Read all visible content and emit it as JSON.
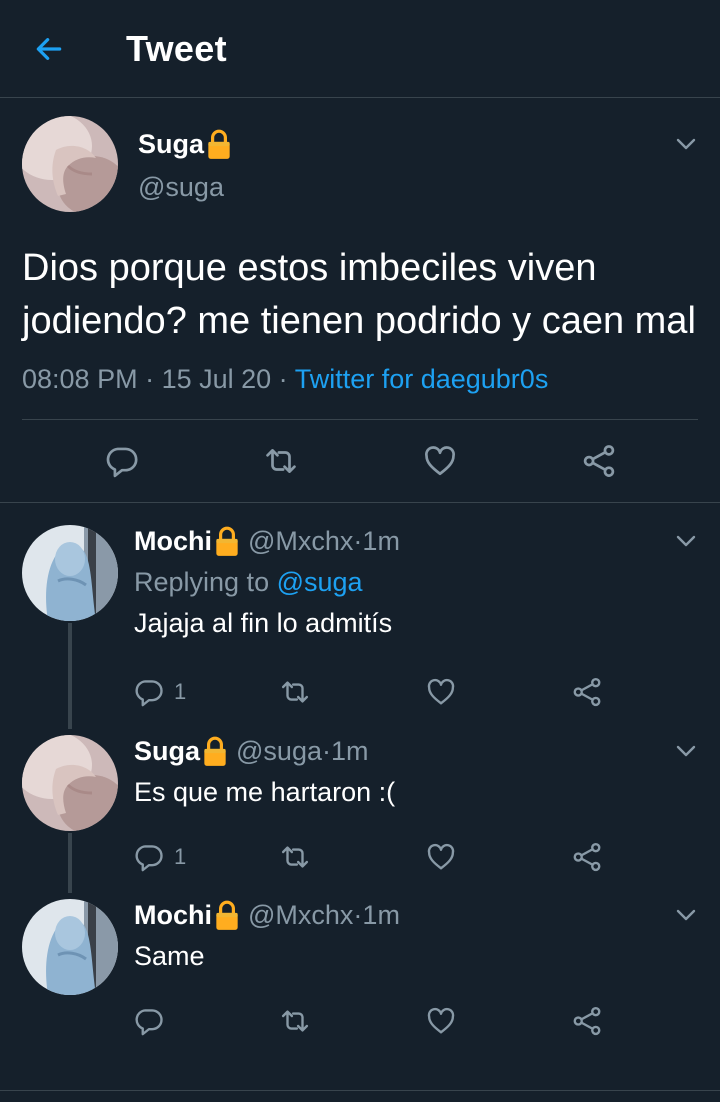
{
  "header": {
    "title": "Tweet"
  },
  "main_tweet": {
    "name": "Suga",
    "handle": "@suga",
    "text": "Dios porque estos imbeciles viven jodiendo? me tienen podrido y caen mal",
    "time": "08:08 PM",
    "date": "15 Jul 20",
    "source": "Twitter for daegubr0s",
    "separator": " · "
  },
  "replies": [
    {
      "name": "Mochi",
      "handle": "@Mxchx",
      "time": "1m",
      "replying_prefix": "Replying to",
      "replying_to": "@suga",
      "text": "Jajaja al fin lo admitís",
      "reply_count": "1"
    },
    {
      "name": "Suga",
      "handle": "@suga",
      "time": "1m",
      "text": "Es que me hartaron :(",
      "reply_count": "1"
    },
    {
      "name": "Mochi",
      "handle": "@Mxchx",
      "time": "1m",
      "text": "Same",
      "reply_count": ""
    }
  ],
  "meta_separator": " · ",
  "colors": {
    "background": "#15202b",
    "divider": "#38444d",
    "secondary_text": "#8899a6",
    "accent": "#1da1f2",
    "lock": "#ffad1f"
  },
  "icons": [
    "back-arrow-icon",
    "lock-icon",
    "chevron-down-icon",
    "reply-icon",
    "retweet-icon",
    "like-icon",
    "share-icon"
  ]
}
